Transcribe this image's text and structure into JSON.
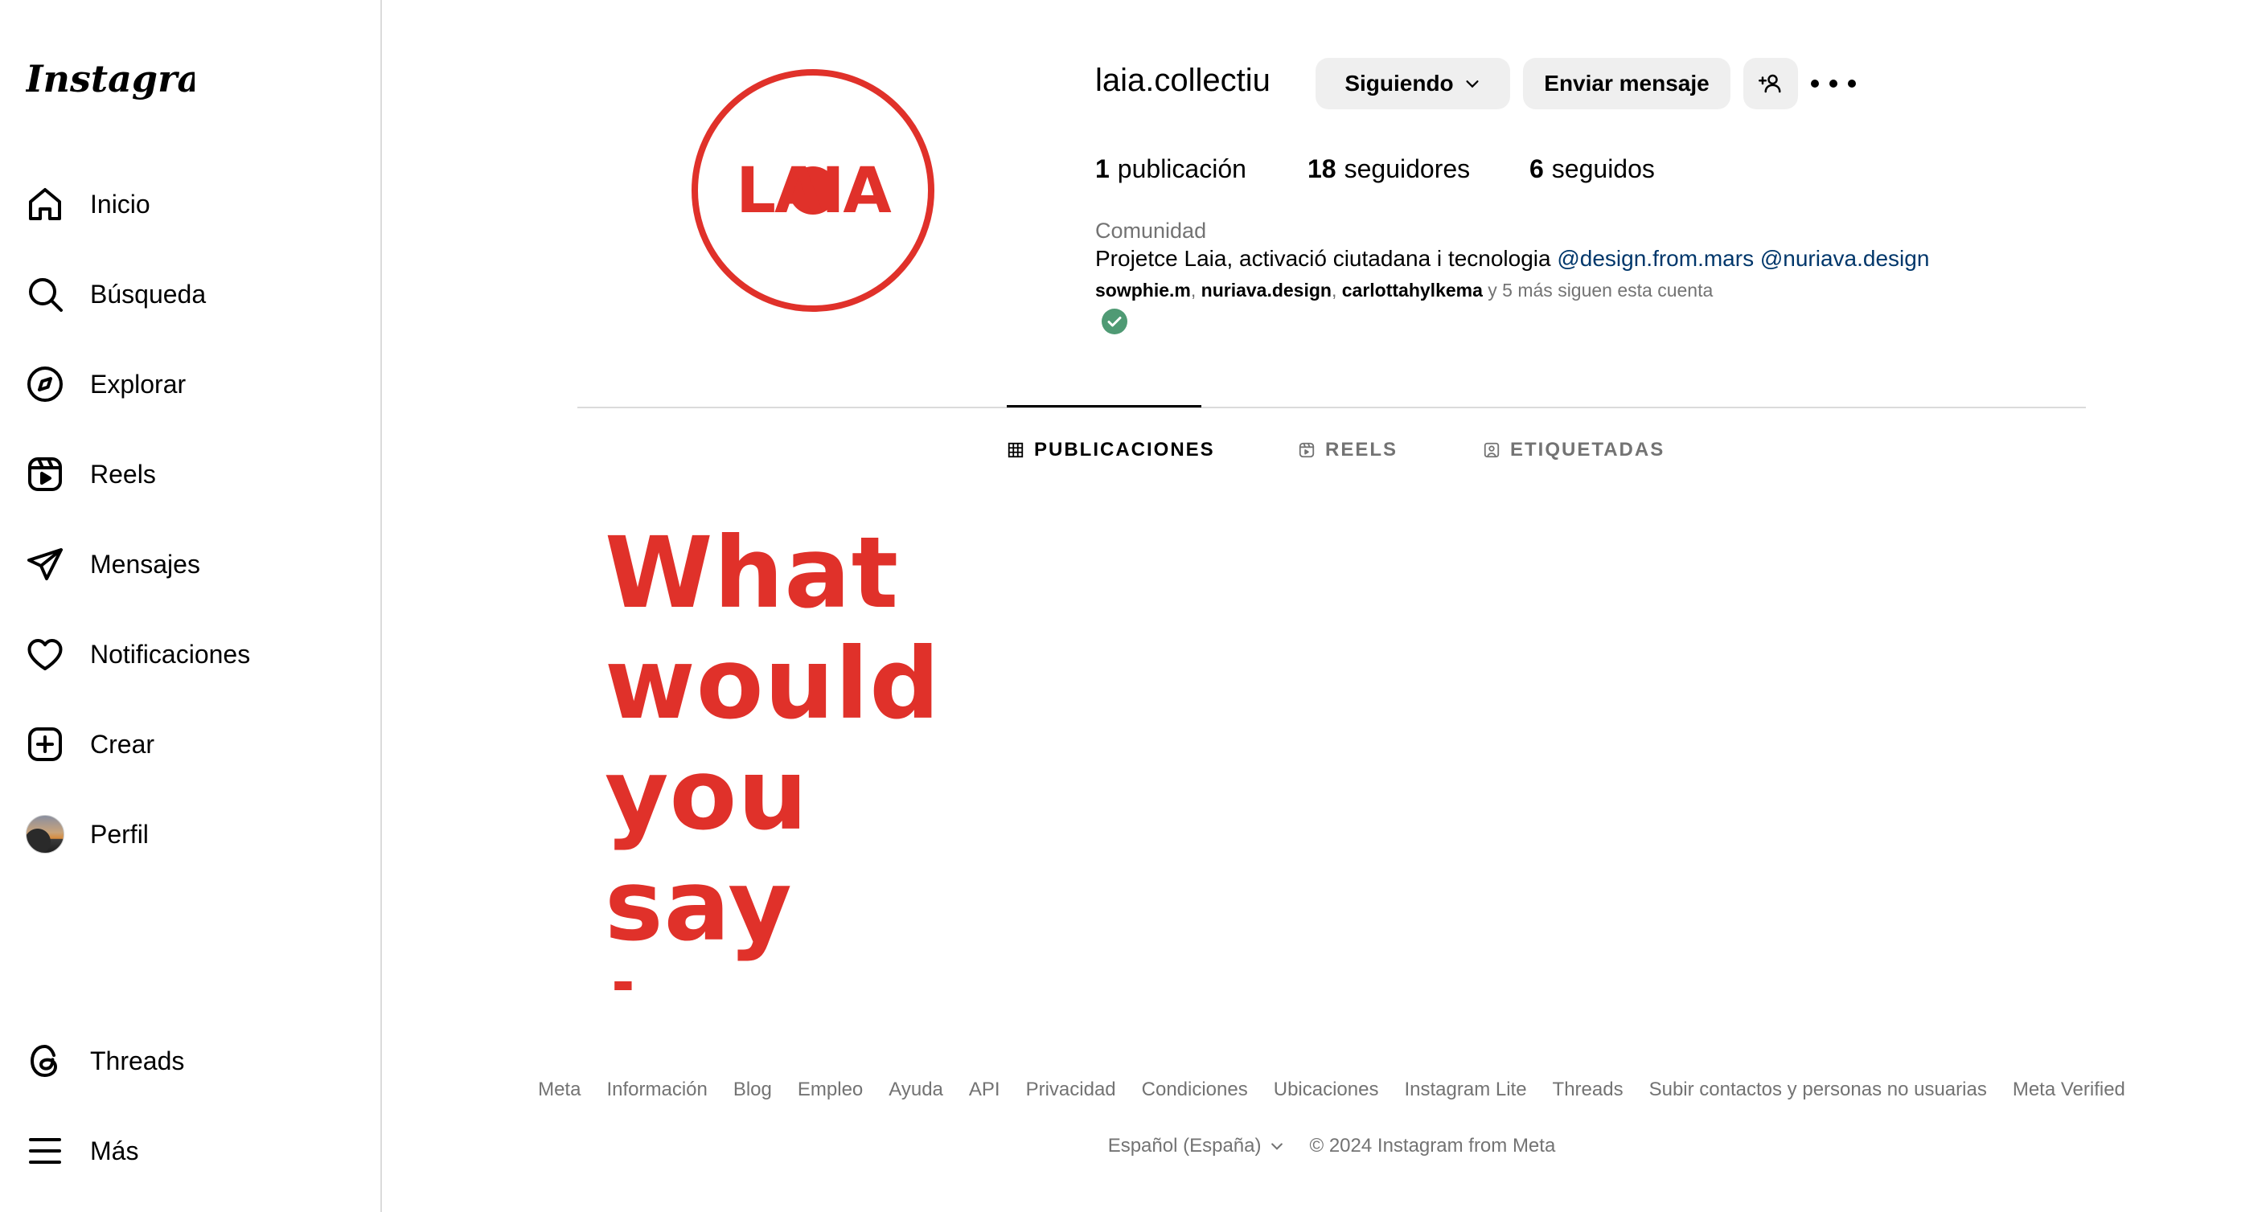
{
  "app": {
    "logo_text": "Instagram"
  },
  "sidebar": {
    "items": [
      {
        "label": "Inicio",
        "icon": "home-icon"
      },
      {
        "label": "Búsqueda",
        "icon": "search-icon"
      },
      {
        "label": "Explorar",
        "icon": "compass-icon"
      },
      {
        "label": "Reels",
        "icon": "reels-icon"
      },
      {
        "label": "Mensajes",
        "icon": "paper-plane-icon"
      },
      {
        "label": "Notificaciones",
        "icon": "heart-icon"
      },
      {
        "label": "Crear",
        "icon": "plus-square-icon"
      },
      {
        "label": "Perfil",
        "icon": "avatar"
      }
    ],
    "bottom_items": [
      {
        "label": "Threads",
        "icon": "threads-icon"
      },
      {
        "label": "Más",
        "icon": "menu-icon"
      }
    ]
  },
  "profile": {
    "avatar_text": "LAIA",
    "username": "laia.collectiu",
    "buttons": {
      "following": "Siguiendo",
      "message": "Enviar mensaje",
      "add_user_icon": "add-user-icon",
      "more_icon": "more-options-icon"
    },
    "stats": {
      "posts_count": "1",
      "posts_label": "publicación",
      "followers_count": "18",
      "followers_label": "seguidores",
      "following_count": "6",
      "following_label": "seguidos"
    },
    "category": "Comunidad",
    "bio_text": "Projetce Laia, activació ciutadana i tecnologia",
    "bio_mention_1": "@design.from.mars",
    "bio_mention_2": "@nuriava.design",
    "followed_by_1": "sowphie.m",
    "followed_by_2": "nuriava.design",
    "followed_by_3": "carlottahylkema",
    "followed_by_suffix": "y 5 más siguen esta cuenta"
  },
  "tabs": [
    {
      "label": "PUBLICACIONES",
      "icon": "grid-icon",
      "active": true
    },
    {
      "label": "REELS",
      "icon": "reels-small-icon",
      "active": false
    },
    {
      "label": "ETIQUETADAS",
      "icon": "tagged-icon",
      "active": false
    }
  ],
  "post": {
    "lines": [
      "What",
      "would",
      "you say",
      "to your"
    ],
    "color": "#e0312a"
  },
  "footer": {
    "links": [
      "Meta",
      "Información",
      "Blog",
      "Empleo",
      "Ayuda",
      "API",
      "Privacidad",
      "Condiciones",
      "Ubicaciones",
      "Instagram Lite",
      "Threads",
      "Subir contactos y personas no usuarias",
      "Meta Verified"
    ],
    "language": "Español (España)",
    "copyright": "© 2024 Instagram from Meta"
  },
  "colors": {
    "brand_red": "#e0312a",
    "link_blue": "#00376b",
    "muted": "#737373",
    "button_bg": "#efefef",
    "verified_green": "#4f9a74"
  }
}
